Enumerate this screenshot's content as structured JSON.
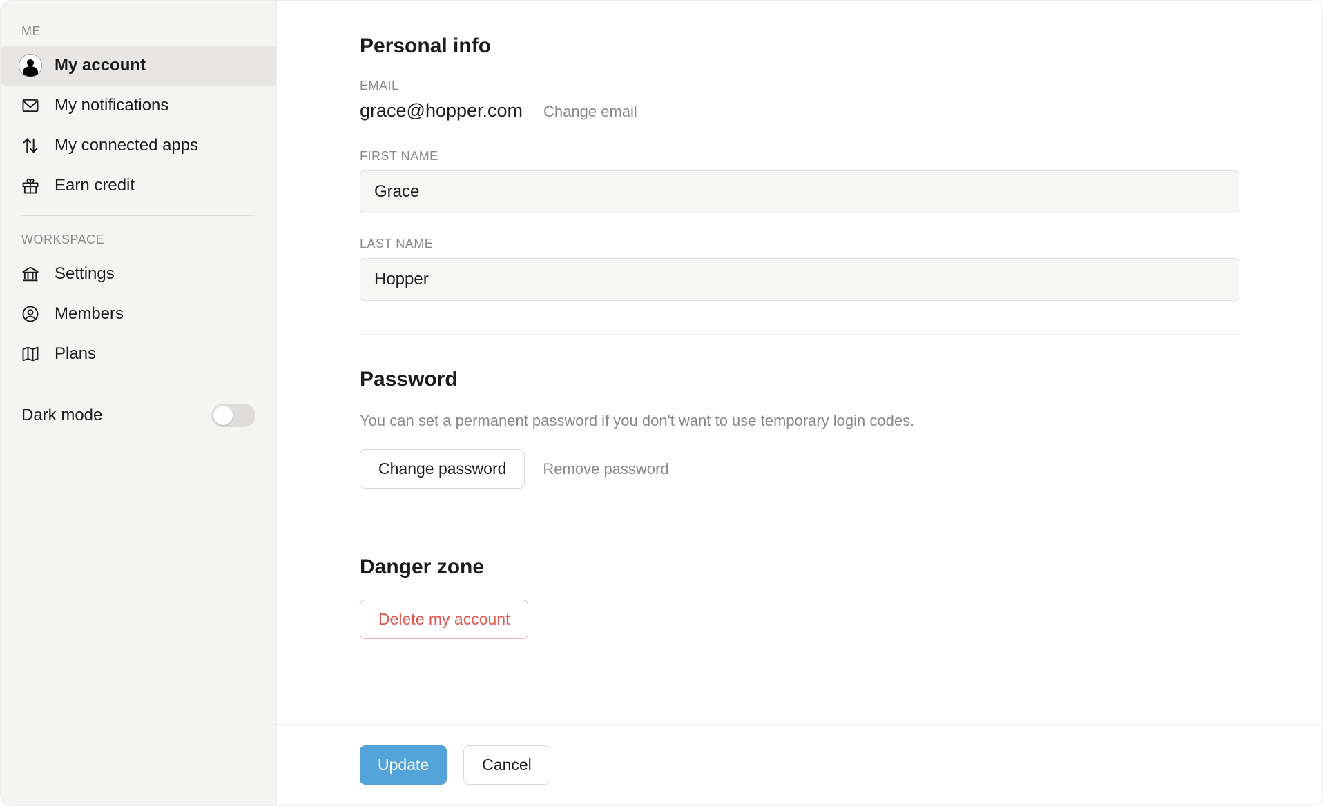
{
  "sidebar": {
    "sections": {
      "me": {
        "label": "ME"
      },
      "workspace": {
        "label": "WORKSPACE"
      }
    },
    "items": {
      "my_account": "My account",
      "my_notifications": "My notifications",
      "my_connected_apps": "My connected apps",
      "earn_credit": "Earn credit",
      "settings": "Settings",
      "members": "Members",
      "plans": "Plans"
    },
    "dark_mode_label": "Dark mode",
    "dark_mode_on": false
  },
  "personal_info": {
    "heading": "Personal info",
    "email_label": "EMAIL",
    "email_value": "grace@hopper.com",
    "change_email": "Change email",
    "first_name_label": "FIRST NAME",
    "first_name_value": "Grace",
    "last_name_label": "LAST NAME",
    "last_name_value": "Hopper"
  },
  "password": {
    "heading": "Password",
    "description": "You can set a permanent password if you don't want to use temporary login codes.",
    "change_button": "Change password",
    "remove_link": "Remove password"
  },
  "danger": {
    "heading": "Danger zone",
    "delete_button": "Delete my account"
  },
  "footer": {
    "update": "Update",
    "cancel": "Cancel"
  }
}
